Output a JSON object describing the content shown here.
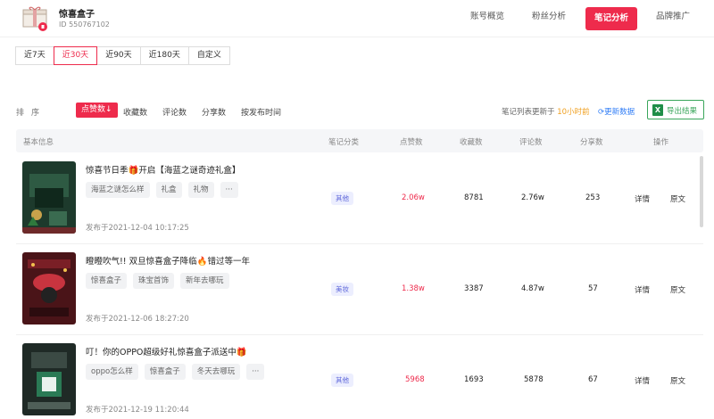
{
  "account": {
    "name": "惊喜盒子",
    "id": "ID 550767102"
  },
  "nav": {
    "overview": "账号概览",
    "fans": "粉丝分析",
    "notes": "笔记分析",
    "brand": "品牌推广"
  },
  "date_tabs": [
    "近7天",
    "近30天",
    "近90天",
    "近180天",
    "自定义"
  ],
  "sort": {
    "label": "排序",
    "options": [
      "点赞数",
      "收藏数",
      "评论数",
      "分享数",
      "按发布时间"
    ],
    "active_indicator": "↓"
  },
  "update": {
    "prefix": "笔记列表更新于",
    "time": "10小时前",
    "refresh": "更新数据",
    "export": "导出结果"
  },
  "table": {
    "headers": [
      "基本信息",
      "笔记分类",
      "点赞数",
      "收藏数",
      "评论数",
      "分享数",
      "操作"
    ],
    "rows": [
      {
        "title": "惊喜节日季🎁开启【海蓝之谜奇迹礼盒】",
        "tags": [
          "海蓝之谜怎么样",
          "礼盒",
          "礼物",
          "···"
        ],
        "published": "发布于2021-12-04 10:17:25",
        "category": "其他",
        "likes": "2.06w",
        "collects": "8781",
        "comments": "2.76w",
        "shares": "253",
        "detail": "详情",
        "original": "原文"
      },
      {
        "title": "瞪瞪吹气!! 双旦惊喜盒子降临🔥错过等一年",
        "tags": [
          "惊喜盒子",
          "珠宝首饰",
          "新年去哪玩"
        ],
        "published": "发布于2021-12-06 18:27:20",
        "category": "美妆",
        "likes": "1.38w",
        "collects": "3387",
        "comments": "4.87w",
        "shares": "57",
        "detail": "详情",
        "original": "原文"
      },
      {
        "title": "叮！你的OPPO超级好礼惊喜盒子派送中🎁",
        "tags": [
          "oppo怎么样",
          "惊喜盒子",
          "冬天去哪玩",
          "···"
        ],
        "published": "发布于2021-12-19 11:20:44",
        "category": "其他",
        "likes": "5968",
        "collects": "1693",
        "comments": "5878",
        "shares": "67",
        "detail": "详情",
        "original": "原文"
      }
    ]
  },
  "colors": {
    "accent": "#ee2b4c",
    "update_time": "#f0a020",
    "refresh": "#2f7cf6",
    "export": "#3aa65b",
    "category_bg": "#eceefe",
    "category_text": "#5c65d9"
  },
  "icons": [
    "gift-box-avatar",
    "refresh-icon",
    "excel-icon",
    "arrow-down-icon"
  ]
}
